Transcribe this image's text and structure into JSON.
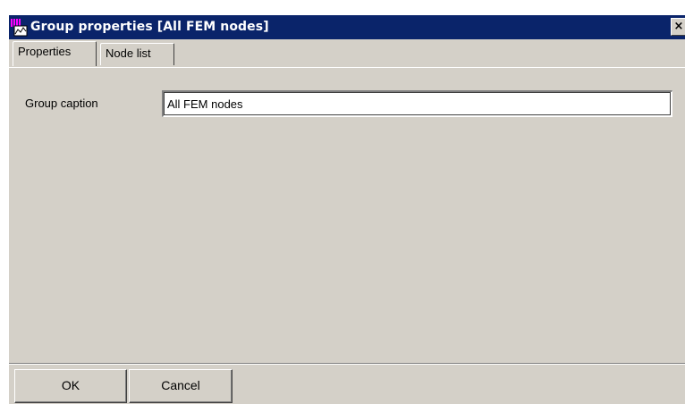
{
  "window": {
    "title": "Group properties [All FEM nodes]",
    "close_label": "×"
  },
  "tabs": [
    {
      "label": "Properties",
      "active": true
    },
    {
      "label": "Node list",
      "active": false
    }
  ],
  "form": {
    "caption_label": "Group caption",
    "caption_value": "All FEM nodes"
  },
  "buttons": {
    "ok_label": "OK",
    "cancel_label": "Cancel"
  },
  "colors": {
    "titlebar": "#0a246a",
    "face": "#d4d0c8",
    "icon_accent": "#ff00ff"
  },
  "icons": {
    "app": "graph-icon",
    "close": "close-icon"
  }
}
